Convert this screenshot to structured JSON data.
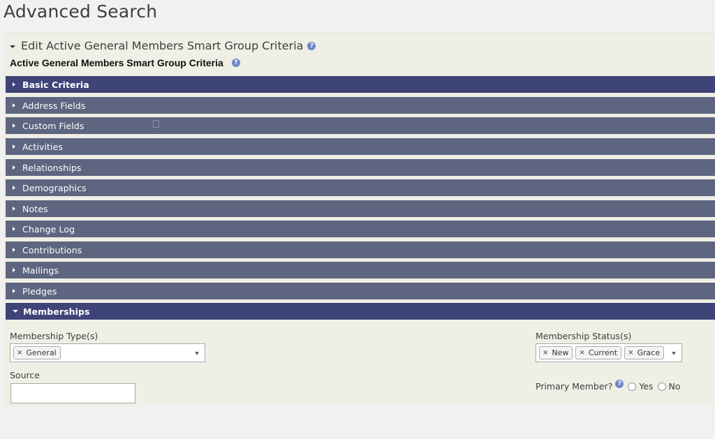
{
  "page_title": "Advanced Search",
  "edit_header": {
    "label": "Edit Active General Members Smart Group Criteria"
  },
  "criteria_title": "Active General Members Smart Group Criteria",
  "sections": {
    "basic": "Basic Criteria",
    "address": "Address Fields",
    "custom": "Custom Fields",
    "activities": "Activities",
    "relationships": "Relationships",
    "demographics": "Demographics",
    "notes": "Notes",
    "changelog": "Change Log",
    "contributions": "Contributions",
    "mailings": "Mailings",
    "pledges": "Pledges",
    "memberships": "Memberships"
  },
  "memberships": {
    "type_label": "Membership Type(s)",
    "type_tags": [
      "General"
    ],
    "status_label": "Membership Status(s)",
    "status_tags": [
      "New",
      "Current",
      "Grace"
    ],
    "source_label": "Source",
    "source_value": "",
    "primary_label": "Primary Member?",
    "primary_options": [
      "Yes",
      "No"
    ]
  },
  "colors": {
    "section_bar": "#5d6580",
    "section_open": "#3e4378",
    "help_icon": "#6d87c8",
    "panel": "#efefe6"
  }
}
